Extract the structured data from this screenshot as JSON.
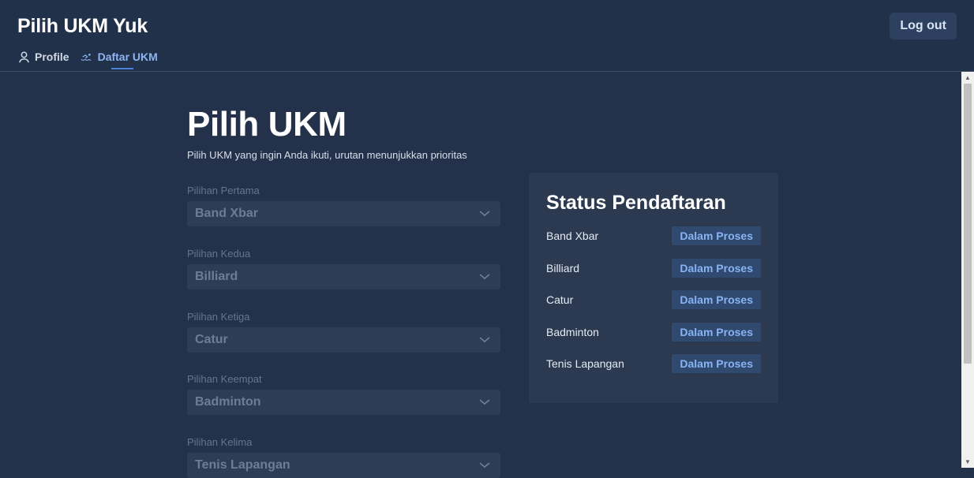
{
  "app": {
    "title": "Pilih UKM Yuk"
  },
  "header": {
    "logout_label": "Log out",
    "nav": [
      {
        "label": "Profile",
        "icon": "user-icon"
      },
      {
        "label": "Daftar UKM",
        "icon": "swimmer-icon",
        "active": true
      }
    ]
  },
  "page": {
    "title": "Pilih UKM",
    "subtitle": "Pilih UKM yang ingin Anda ikuti, urutan menunjukkan prioritas"
  },
  "choices": [
    {
      "label": "Pilihan Pertama",
      "value": "Band Xbar"
    },
    {
      "label": "Pilihan Kedua",
      "value": "Billiard"
    },
    {
      "label": "Pilihan Ketiga",
      "value": "Catur"
    },
    {
      "label": "Pilihan Keempat",
      "value": "Badminton"
    },
    {
      "label": "Pilihan Kelima",
      "value": "Tenis Lapangan"
    }
  ],
  "status": {
    "title": "Status Pendaftaran",
    "rows": [
      {
        "name": "Band Xbar",
        "badge": "Dalam Proses"
      },
      {
        "name": "Billiard",
        "badge": "Dalam Proses"
      },
      {
        "name": "Catur",
        "badge": "Dalam Proses"
      },
      {
        "name": "Badminton",
        "badge": "Dalam Proses"
      },
      {
        "name": "Tenis Lapangan",
        "badge": "Dalam Proses"
      }
    ]
  },
  "colors": {
    "background": "#23324a",
    "accent": "#4b7fd8",
    "badge_text": "#88b4f4",
    "badge_bg": "#2f4a6e"
  }
}
